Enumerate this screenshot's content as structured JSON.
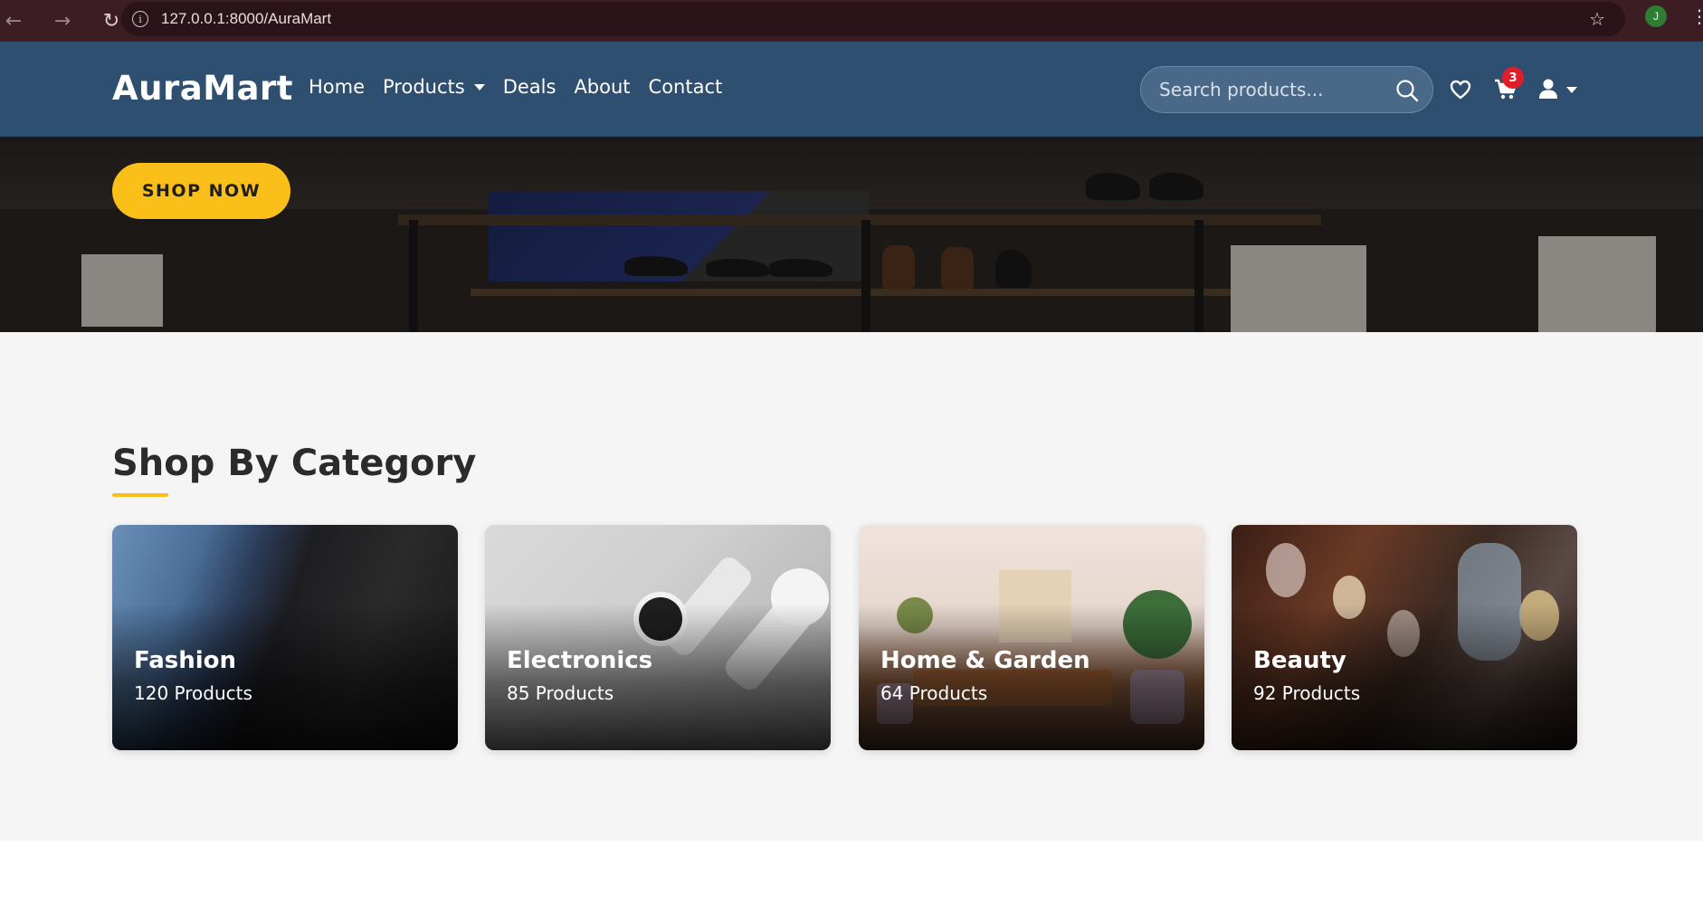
{
  "browser": {
    "url": "127.0.0.1:8000/AuraMart",
    "profile_initial": "J"
  },
  "header": {
    "logo": "AuraMart",
    "nav": [
      {
        "label": "Home"
      },
      {
        "label": "Products"
      },
      {
        "label": "Deals"
      },
      {
        "label": "About"
      },
      {
        "label": "Contact"
      }
    ],
    "search_placeholder": "Search products...",
    "cart_count": "3"
  },
  "hero": {
    "cta_label": "SHOP NOW"
  },
  "categories": {
    "title": "Shop By Category",
    "items": [
      {
        "name": "Fashion",
        "count": "120 Products"
      },
      {
        "name": "Electronics",
        "count": "85 Products"
      },
      {
        "name": "Home & Garden",
        "count": "64 Products"
      },
      {
        "name": "Beauty",
        "count": "92 Products"
      }
    ]
  },
  "colors": {
    "header_bg": "#2f4f70",
    "accent": "#fbbf1a",
    "badge": "#e11d2a",
    "browser_bar": "#3b1d23"
  },
  "icons": [
    "back-arrow-icon",
    "forward-arrow-icon",
    "reload-icon",
    "info-icon",
    "star-icon",
    "more-vert-icon",
    "search-icon",
    "heart-icon",
    "cart-icon",
    "user-icon",
    "chevron-down-icon"
  ]
}
